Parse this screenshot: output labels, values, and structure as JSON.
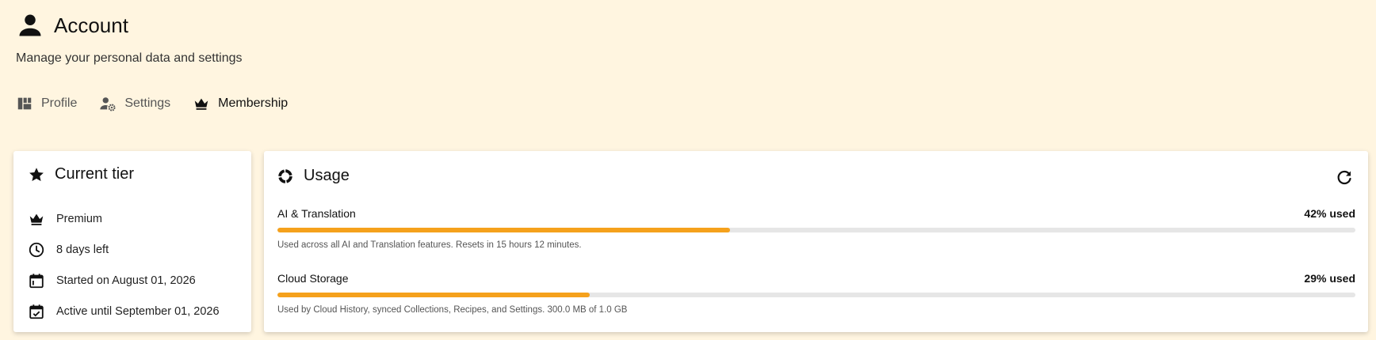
{
  "header": {
    "icon": "person-icon",
    "title": "Account",
    "subtitle": "Manage your personal data and settings"
  },
  "tabs": [
    {
      "label": "Profile",
      "icon": "dashboard-icon",
      "active": false
    },
    {
      "label": "Settings",
      "icon": "manage-accounts-icon",
      "active": false
    },
    {
      "label": "Membership",
      "icon": "crown-icon",
      "active": true
    }
  ],
  "tier_card": {
    "title": "Current tier",
    "icon": "star-icon",
    "items": [
      {
        "icon": "crown-icon",
        "text": "Premium"
      },
      {
        "icon": "clock-icon",
        "text": "8 days left"
      },
      {
        "icon": "calendar-start-icon",
        "text": "Started on August 01, 2026"
      },
      {
        "icon": "calendar-check-icon",
        "text": "Active until September 01, 2026"
      }
    ]
  },
  "usage_card": {
    "title": "Usage",
    "icon": "donut-icon",
    "refresh_icon": "refresh-icon",
    "items": [
      {
        "name": "AI & Translation",
        "percent_label": "42% used",
        "fraction": 0.42,
        "description": "Used across all AI and Translation features. Resets in 15 hours 12 minutes."
      },
      {
        "name": "Cloud Storage",
        "percent_label": "29% used",
        "fraction": 0.29,
        "description": "Used by Cloud History, synced Collections, Recipes, and Settings. 300.0 MB of 1.0 GB"
      }
    ]
  },
  "colors": {
    "background": "#fff5e0",
    "accent": "#f5a11c",
    "track": "#e6e6e6"
  }
}
